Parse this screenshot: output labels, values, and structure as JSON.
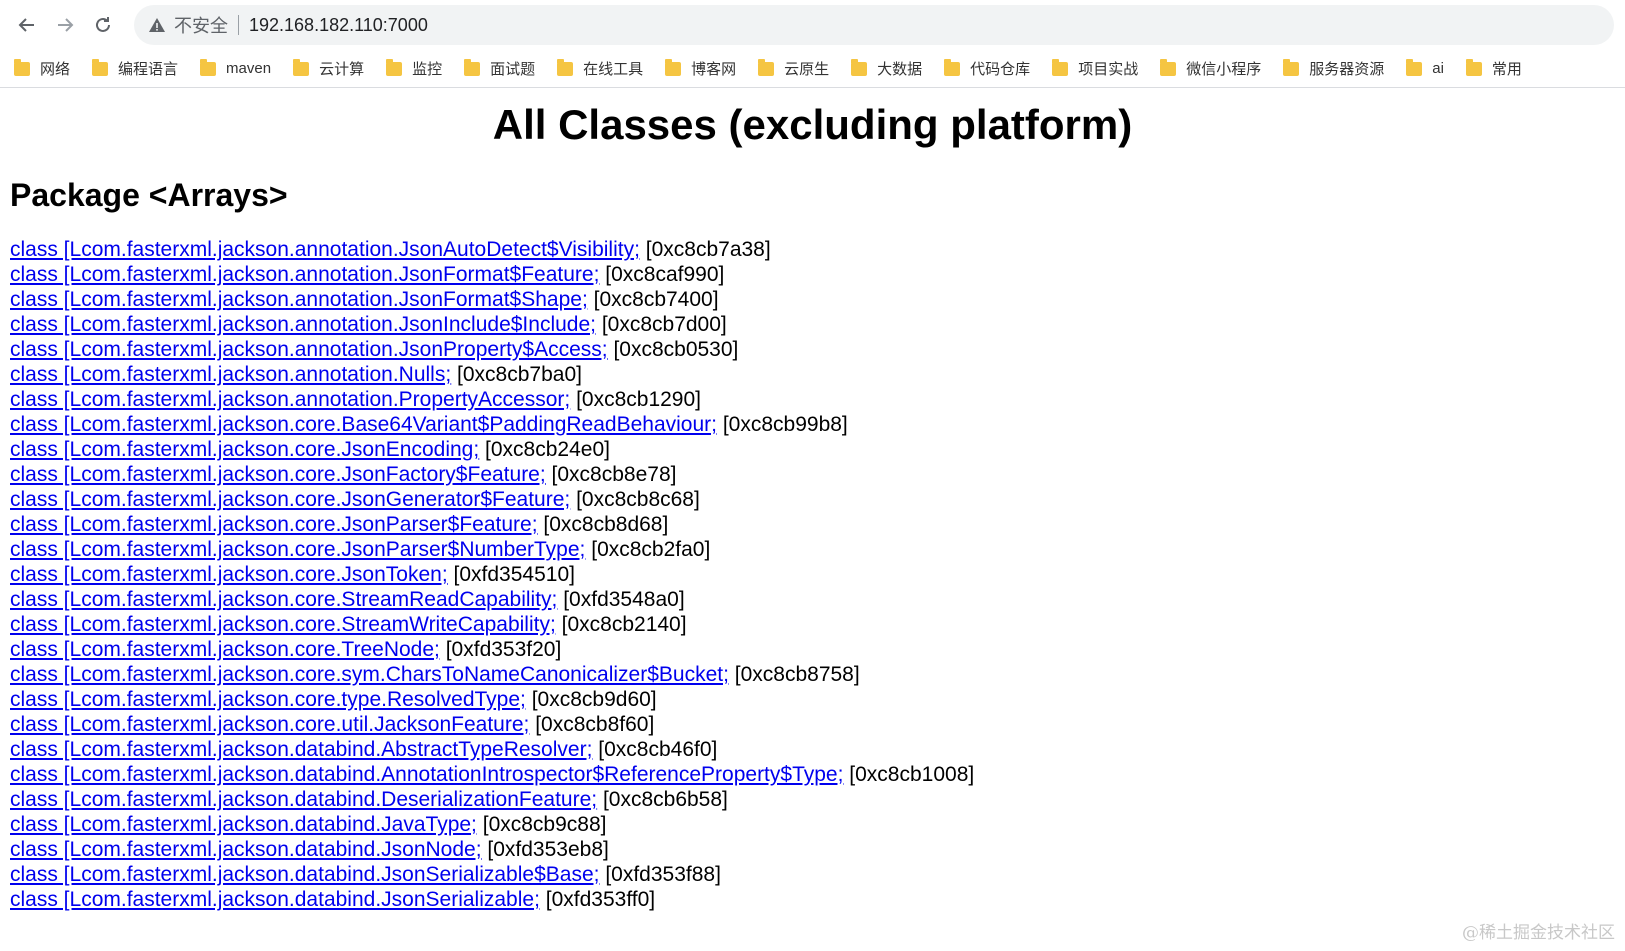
{
  "addressbar": {
    "insecure_label": "不安全",
    "url": "192.168.182.110:7000"
  },
  "bookmarks": [
    "网络",
    "编程语言",
    "maven",
    "云计算",
    "监控",
    "面试题",
    "在线工具",
    "博客网",
    "云原生",
    "大数据",
    "代码仓库",
    "项目实战",
    "微信小程序",
    "服务器资源",
    "ai",
    "常用"
  ],
  "page": {
    "title": "All Classes (excluding platform)",
    "package_title": "Package <Arrays>",
    "classes": [
      {
        "name": "class [Lcom.fasterxml.jackson.annotation.JsonAutoDetect$Visibility;",
        "addr": "[0xc8cb7a38]"
      },
      {
        "name": "class [Lcom.fasterxml.jackson.annotation.JsonFormat$Feature;",
        "addr": "[0xc8caf990]"
      },
      {
        "name": "class [Lcom.fasterxml.jackson.annotation.JsonFormat$Shape;",
        "addr": "[0xc8cb7400]"
      },
      {
        "name": "class [Lcom.fasterxml.jackson.annotation.JsonInclude$Include;",
        "addr": "[0xc8cb7d00]"
      },
      {
        "name": "class [Lcom.fasterxml.jackson.annotation.JsonProperty$Access;",
        "addr": "[0xc8cb0530]"
      },
      {
        "name": "class [Lcom.fasterxml.jackson.annotation.Nulls;",
        "addr": "[0xc8cb7ba0]"
      },
      {
        "name": "class [Lcom.fasterxml.jackson.annotation.PropertyAccessor;",
        "addr": "[0xc8cb1290]"
      },
      {
        "name": "class [Lcom.fasterxml.jackson.core.Base64Variant$PaddingReadBehaviour;",
        "addr": "[0xc8cb99b8]"
      },
      {
        "name": "class [Lcom.fasterxml.jackson.core.JsonEncoding;",
        "addr": "[0xc8cb24e0]"
      },
      {
        "name": "class [Lcom.fasterxml.jackson.core.JsonFactory$Feature;",
        "addr": "[0xc8cb8e78]"
      },
      {
        "name": "class [Lcom.fasterxml.jackson.core.JsonGenerator$Feature;",
        "addr": "[0xc8cb8c68]"
      },
      {
        "name": "class [Lcom.fasterxml.jackson.core.JsonParser$Feature;",
        "addr": "[0xc8cb8d68]"
      },
      {
        "name": "class [Lcom.fasterxml.jackson.core.JsonParser$NumberType;",
        "addr": "[0xc8cb2fa0]"
      },
      {
        "name": "class [Lcom.fasterxml.jackson.core.JsonToken;",
        "addr": "[0xfd354510]"
      },
      {
        "name": "class [Lcom.fasterxml.jackson.core.StreamReadCapability;",
        "addr": "[0xfd3548a0]"
      },
      {
        "name": "class [Lcom.fasterxml.jackson.core.StreamWriteCapability;",
        "addr": "[0xc8cb2140]"
      },
      {
        "name": "class [Lcom.fasterxml.jackson.core.TreeNode;",
        "addr": "[0xfd353f20]"
      },
      {
        "name": "class [Lcom.fasterxml.jackson.core.sym.CharsToNameCanonicalizer$Bucket;",
        "addr": "[0xc8cb8758]"
      },
      {
        "name": "class [Lcom.fasterxml.jackson.core.type.ResolvedType;",
        "addr": "[0xc8cb9d60]"
      },
      {
        "name": "class [Lcom.fasterxml.jackson.core.util.JacksonFeature;",
        "addr": "[0xc8cb8f60]"
      },
      {
        "name": "class [Lcom.fasterxml.jackson.databind.AbstractTypeResolver;",
        "addr": "[0xc8cb46f0]"
      },
      {
        "name": "class [Lcom.fasterxml.jackson.databind.AnnotationIntrospector$ReferenceProperty$Type;",
        "addr": "[0xc8cb1008]"
      },
      {
        "name": "class [Lcom.fasterxml.jackson.databind.DeserializationFeature;",
        "addr": "[0xc8cb6b58]"
      },
      {
        "name": "class [Lcom.fasterxml.jackson.databind.JavaType;",
        "addr": "[0xc8cb9c88]"
      },
      {
        "name": "class [Lcom.fasterxml.jackson.databind.JsonNode;",
        "addr": "[0xfd353eb8]"
      },
      {
        "name": "class [Lcom.fasterxml.jackson.databind.JsonSerializable$Base;",
        "addr": "[0xfd353f88]"
      },
      {
        "name": "class [Lcom.fasterxml.jackson.databind.JsonSerializable;",
        "addr": "[0xfd353ff0]"
      }
    ]
  },
  "watermark": "@稀土掘金技术社区"
}
